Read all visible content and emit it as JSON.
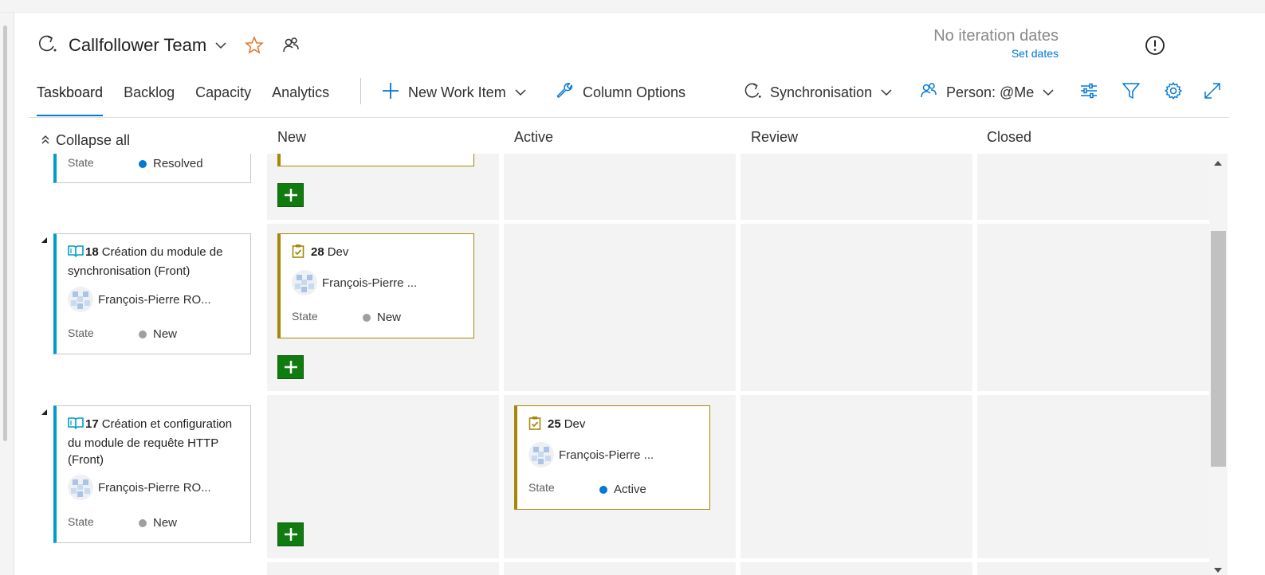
{
  "header": {
    "team_name": "Callfollower Team",
    "iteration_dates": "No iteration dates",
    "set_dates_link": "Set dates"
  },
  "tabs": [
    {
      "label": "Taskboard",
      "active": true
    },
    {
      "label": "Backlog",
      "active": false
    },
    {
      "label": "Capacity",
      "active": false
    },
    {
      "label": "Analytics",
      "active": false
    }
  ],
  "commands": {
    "new_work_item": "New Work Item",
    "column_options": "Column Options",
    "iteration_selector": "Synchronisation",
    "person_filter": "Person: @Me"
  },
  "board": {
    "collapse_all": "Collapse all",
    "columns": [
      "New",
      "Active",
      "Review",
      "Closed"
    ],
    "rows": [
      {
        "backlog_item": {
          "state_label": "State",
          "state": "Resolved"
        }
      },
      {
        "backlog_item": {
          "id": "18",
          "title": "Création du module de synchronisation (Front)",
          "assignee": "François-Pierre RO...",
          "state_label": "State",
          "state": "New"
        },
        "tasks": [
          {
            "id": "28",
            "title": "Dev",
            "assignee": "François-Pierre ...",
            "state_label": "State",
            "state": "New",
            "column": "New"
          }
        ]
      },
      {
        "backlog_item": {
          "id": "17",
          "title": "Création et configuration du module de requête HTTP (Front)",
          "assignee": "François-Pierre RO...",
          "state_label": "State",
          "state": "New"
        },
        "tasks": [
          {
            "id": "25",
            "title": "Dev",
            "assignee": "François-Pierre ...",
            "state_label": "State",
            "state": "Active",
            "column": "Active"
          }
        ]
      }
    ]
  },
  "colors": {
    "accent": "#0078d4",
    "add_button": "#107c10",
    "story_bar": "#009ccc",
    "task_bar": "#a4880a",
    "state_new": "#a19f9d",
    "state_active": "#0078d4",
    "state_resolved": "#0078d4",
    "favorite_star": "#e3732b"
  }
}
